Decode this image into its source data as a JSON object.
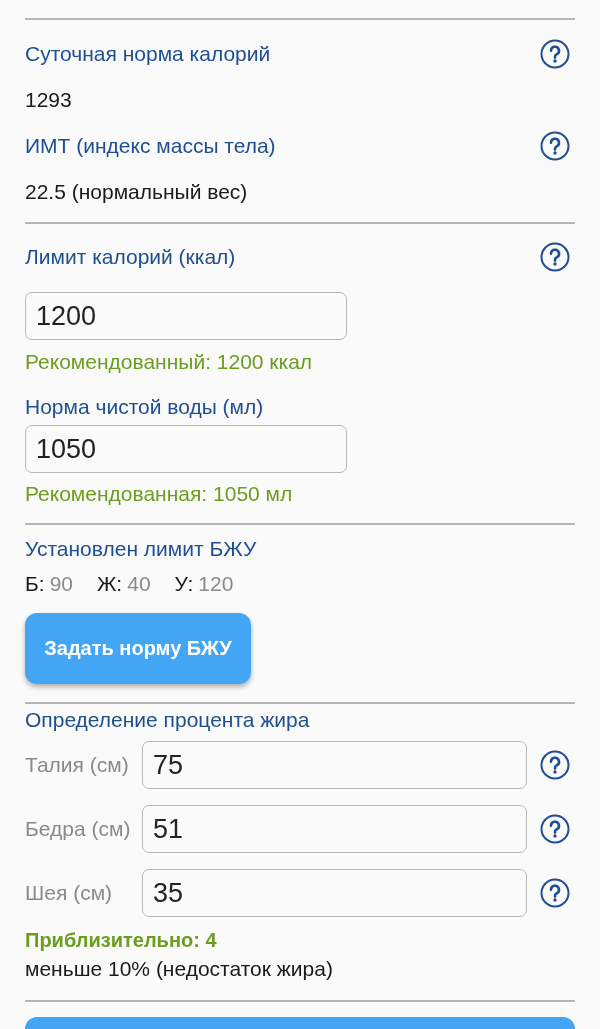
{
  "stats": [
    {
      "label": "Суточная норма калорий",
      "help": true,
      "value": "1293"
    },
    {
      "label": "ИМТ (индекс массы тела)",
      "help": true,
      "value": "22.5 (нормальный вес)"
    }
  ],
  "calorie_limit": {
    "label": "Лимит калорий (ккал)",
    "help": true,
    "value": "1200",
    "hint": "Рекомендованный: 1200 ккал"
  },
  "water": {
    "label": "Норма чистой воды (мл)",
    "value": "1050",
    "hint": "Рекомендованная: 1050 мл"
  },
  "macros": {
    "title": "Установлен лимит БЖУ",
    "items": [
      {
        "letter": "Б:",
        "value": "90"
      },
      {
        "letter": "Ж:",
        "value": "40"
      },
      {
        "letter": "У:",
        "value": "120"
      }
    ],
    "button": "Задать норму БЖУ"
  },
  "body_fat": {
    "title": "Определение процента жира",
    "fields": [
      {
        "label": "Талия (см)",
        "value": "75",
        "help": true
      },
      {
        "label": "Бедра (см)",
        "value": "51",
        "help": true
      },
      {
        "label": "Шея (см)",
        "value": "35",
        "help": true
      }
    ],
    "result": "Приблизительно: 4",
    "note": "меньше 10% (недостаток жира)"
  }
}
